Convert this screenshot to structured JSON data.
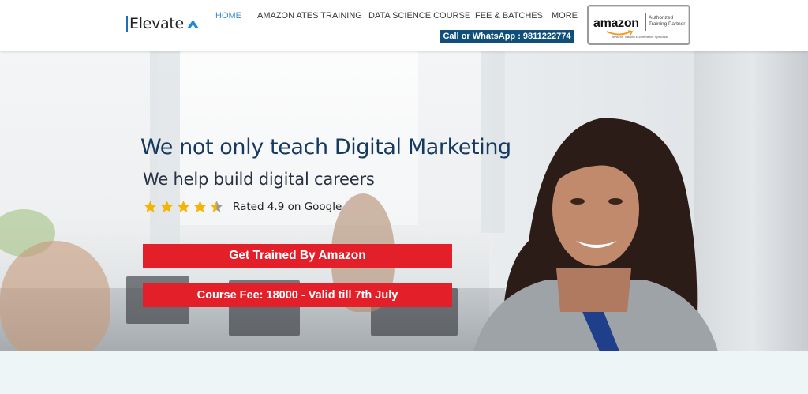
{
  "header": {
    "logo_text": "Elevate",
    "nav": [
      {
        "label": "HOME",
        "active": true
      },
      {
        "label": "AMAZON ATES TRAINING",
        "active": false
      },
      {
        "label": "DATA SCIENCE COURSE",
        "active": false
      },
      {
        "label": "FEE & BATCHES",
        "active": false
      },
      {
        "label": "MORE",
        "active": false
      }
    ],
    "phone_label": "Call or WhatsApp : 9811222774",
    "badge": {
      "brand": "amazon",
      "partner_line1": "Authorized",
      "partner_line2": "Training Partner",
      "tagline": "Amazon Trained E-commerce Specialist"
    }
  },
  "hero": {
    "headline": "We not only teach Digital Marketing",
    "subhead": "We help build digital careers",
    "rating": {
      "value": 4.5,
      "max": 5,
      "text": "Rated 4.9 on Google"
    },
    "cta_primary": "Get Trained By Amazon",
    "cta_secondary": "Course Fee: 18000 - Valid till 7th July"
  },
  "colors": {
    "accent_blue": "#3e8ed0",
    "headline_navy": "#163a5f",
    "phone_bg": "#0f4f7a",
    "cta_red": "#e3202a",
    "star_gold": "#f5b400"
  }
}
